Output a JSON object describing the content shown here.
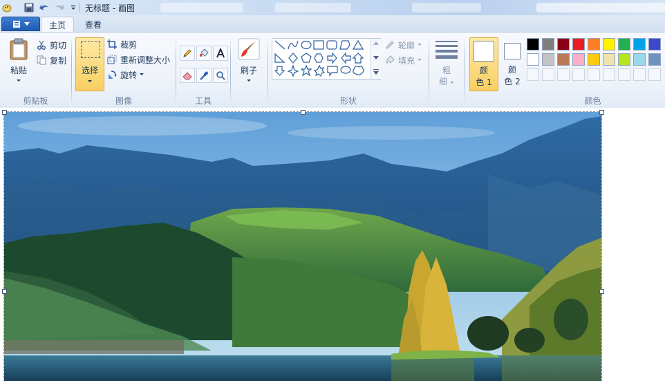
{
  "title_bar": {
    "title": "无标题 - 画图",
    "quick_access": [
      "save-icon",
      "undo-icon",
      "redo-icon",
      "customize-dropdown-icon"
    ]
  },
  "tabs": {
    "file_menu_icon": "menu-icon",
    "items": [
      {
        "label": "主页",
        "active": true
      },
      {
        "label": "查看",
        "active": false
      }
    ]
  },
  "ribbon": {
    "clipboard": {
      "label": "剪贴板",
      "paste_label": "粘贴",
      "cut_label": "剪切",
      "copy_label": "复制"
    },
    "image": {
      "label": "图像",
      "select_label": "选择",
      "crop_label": "裁剪",
      "resize_label": "重新调整大小",
      "rotate_label": "旋转"
    },
    "tools": {
      "label": "工具",
      "items": [
        "pencil-icon",
        "fill-bucket-icon",
        "text-icon",
        "eraser-icon",
        "color-picker-icon",
        "magnifier-icon"
      ]
    },
    "brushes": {
      "label": "刷子"
    },
    "shapes": {
      "label": "形状",
      "outline_label": "轮廓",
      "fill_label": "填充"
    },
    "size": {
      "label_line1": "粗",
      "label_line2": "细"
    },
    "colors": {
      "label": "颜色",
      "color1": {
        "line1": "颜",
        "line2": "色 1",
        "value": "#ffffff"
      },
      "color2": {
        "line1": "颜",
        "line2": "色 2",
        "value": "#ffffff"
      },
      "palette_row1": [
        "#000000",
        "#7f7f7f",
        "#880015",
        "#ed1c24",
        "#ff7f27",
        "#fff200",
        "#22b14c",
        "#00a2e8",
        "#3f48cc"
      ],
      "palette_row2": [
        "#ffffff",
        "#c3c3c3",
        "#b97a57",
        "#ffaec9",
        "#ffc90e",
        "#efe4b0",
        "#b5e61d",
        "#99d9ea",
        "#7092be"
      ]
    }
  },
  "canvas": {
    "image_description": "mountain-lake-landscape"
  }
}
